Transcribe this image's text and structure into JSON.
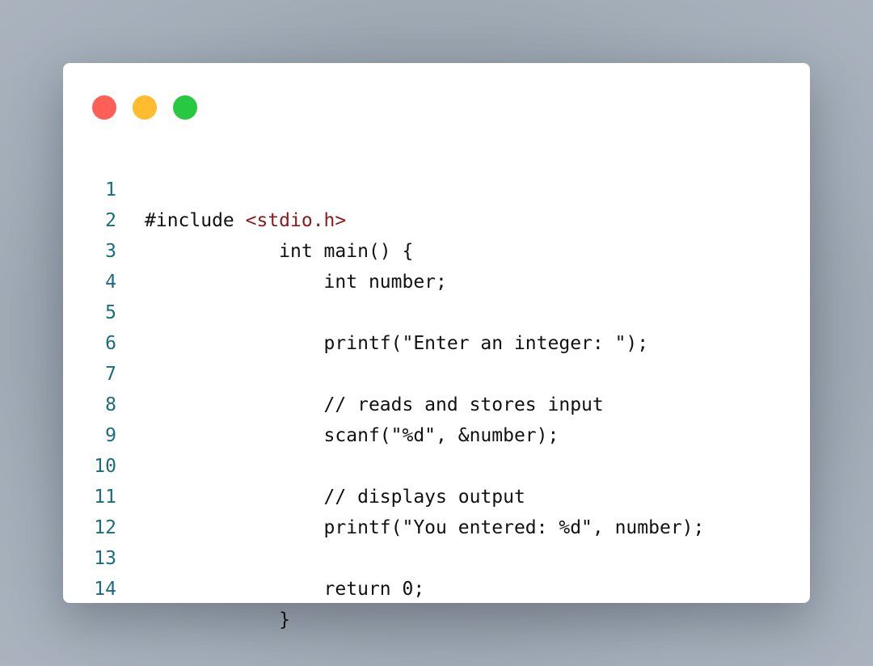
{
  "window": {
    "controls": {
      "close_color": "#ff5f57",
      "minimize_color": "#febc2e",
      "maximize_color": "#28c840"
    }
  },
  "code": {
    "line_number_color": "#1b6b81",
    "include_color": "#8b1a1a",
    "lines": [
      {
        "n": "1",
        "text": "#include ",
        "include": "<stdio.h>"
      },
      {
        "n": "2",
        "text": "            int main() {"
      },
      {
        "n": "3",
        "text": "                int number;"
      },
      {
        "n": "4",
        "text": ""
      },
      {
        "n": "5",
        "text": "                printf(\"Enter an integer: \");"
      },
      {
        "n": "6",
        "text": ""
      },
      {
        "n": "7",
        "text": "                // reads and stores input"
      },
      {
        "n": "8",
        "text": "                scanf(\"%d\", &number);"
      },
      {
        "n": "9",
        "text": ""
      },
      {
        "n": "10",
        "text": "                // displays output"
      },
      {
        "n": "11",
        "text": "                printf(\"You entered: %d\", number);"
      },
      {
        "n": "12",
        "text": ""
      },
      {
        "n": "13",
        "text": "                return 0;"
      },
      {
        "n": "14",
        "text": "            }"
      }
    ]
  }
}
